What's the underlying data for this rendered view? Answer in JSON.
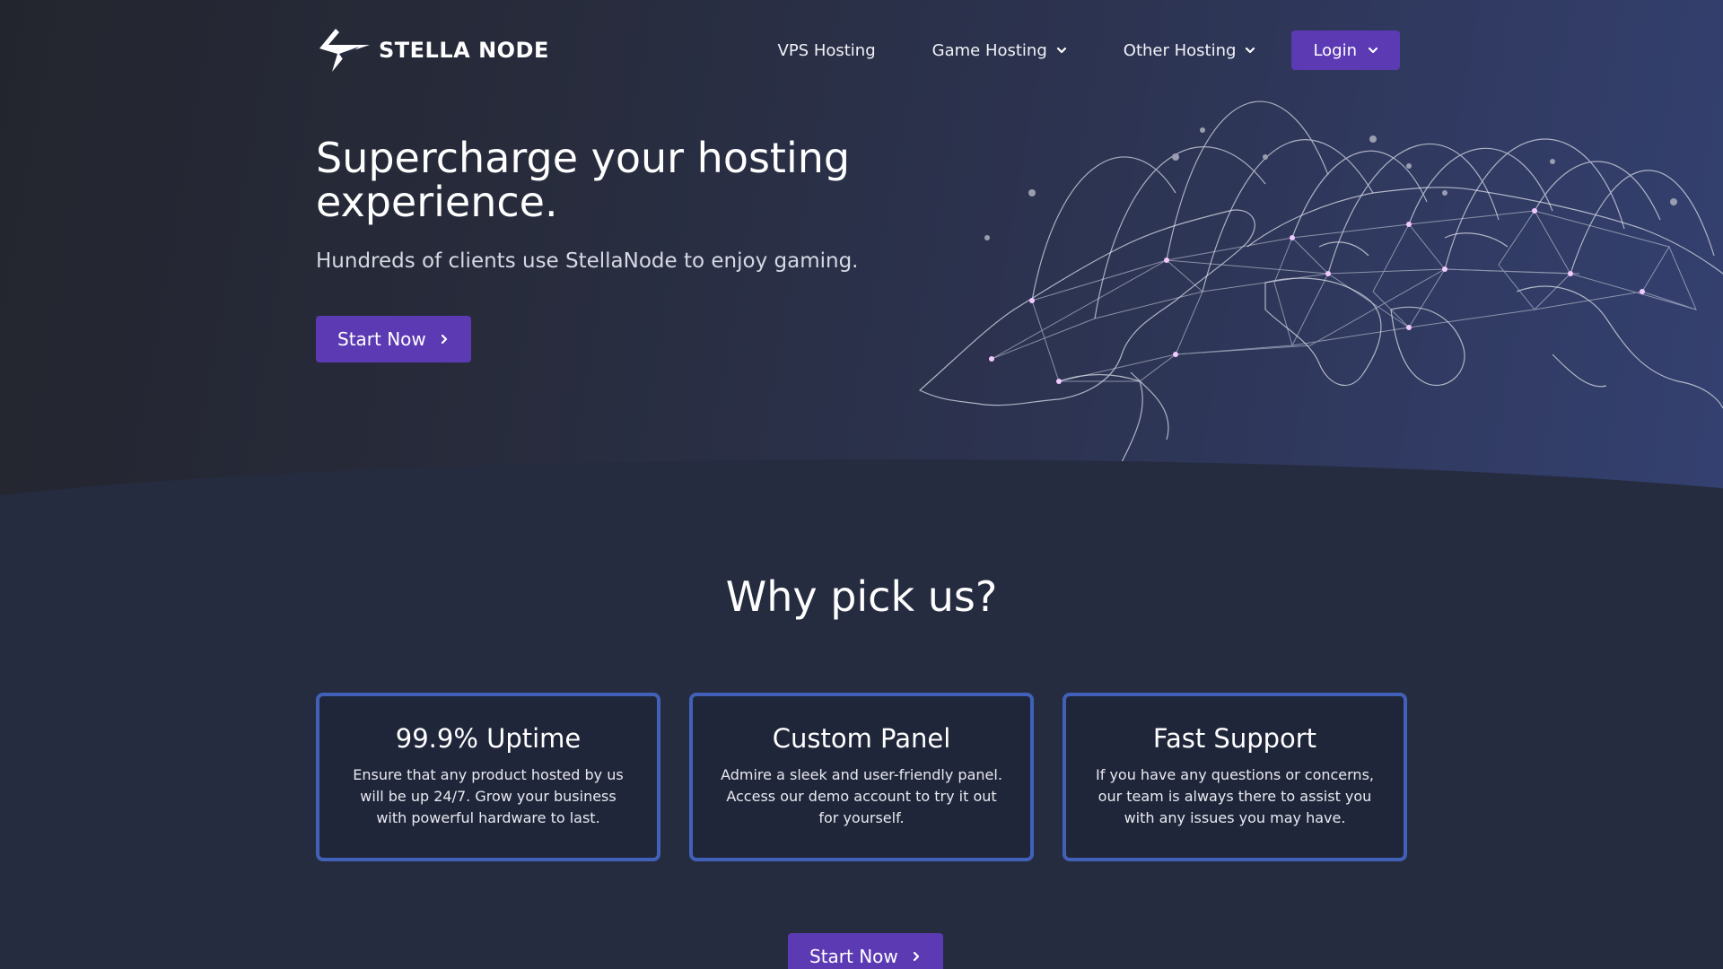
{
  "brand": {
    "name": "STELLA NODE"
  },
  "nav": {
    "links": [
      {
        "label": "VPS Hosting"
      },
      {
        "label": "Game Hosting"
      },
      {
        "label": "Other Hosting"
      }
    ],
    "login_label": "Login"
  },
  "hero": {
    "title": "Supercharge your hosting experience.",
    "subtitle": "Hundreds of clients use StellaNode to enjoy gaming.",
    "cta_label": "Start Now"
  },
  "why": {
    "title": "Why pick us?",
    "cards": [
      {
        "title": "99.9% Uptime",
        "body": "Ensure that any product hosted by us will be up 24/7. Grow your business with powerful hardware to last."
      },
      {
        "title": "Custom Panel",
        "body": "Admire a sleek and user-friendly panel. Access our demo account to try it out for yourself."
      },
      {
        "title": "Fast Support",
        "body": "If you have any questions or concerns, our team is always there to assist you with any issues you may have."
      }
    ],
    "cta_label": "Start Now"
  },
  "colors": {
    "accent": "#5c3ab3",
    "card_border": "#4161b8",
    "background": "#262c40"
  },
  "icons": {
    "logo": "stella-star-logo",
    "chevron": "chevron-down-icon",
    "arrow": "chevron-right-icon",
    "globe": "world-network-globe"
  }
}
